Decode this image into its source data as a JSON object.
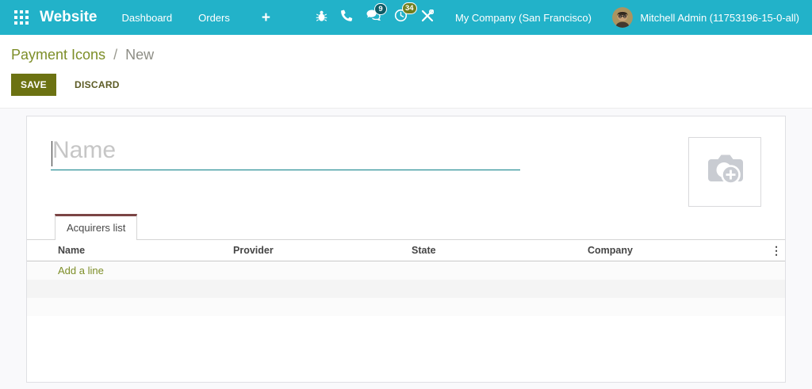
{
  "navbar": {
    "brand": "Website",
    "items": [
      {
        "label": "Dashboard"
      },
      {
        "label": "Orders"
      }
    ],
    "plus": "+",
    "badges": {
      "messages": "9",
      "activities": "34"
    },
    "company": "My Company (San Francisco)",
    "user": "Mitchell Admin (11753196-15-0-all)"
  },
  "breadcrumb": {
    "parent": "Payment Icons",
    "separator": "/",
    "current": "New"
  },
  "toolbar": {
    "save": "SAVE",
    "discard": "DISCARD"
  },
  "sheet": {
    "name_placeholder": "Name",
    "tabs": [
      {
        "label": "Acquirers list",
        "active": true
      }
    ],
    "acquirers_table": {
      "columns": [
        "Name",
        "Provider",
        "State",
        "Company"
      ],
      "options_icon_glyph": "⋮",
      "add_line_label": "Add a line",
      "rows": []
    }
  },
  "colors": {
    "navbar_bg": "#22b2c9",
    "accent_olive": "#6c7212",
    "link_olive": "#7d8e28",
    "tab_top_border": "#7b4545",
    "input_underline": "#0a7e87",
    "messages_badge_bg": "#0d5c66",
    "activities_badge_bg": "#6f7f1f"
  }
}
